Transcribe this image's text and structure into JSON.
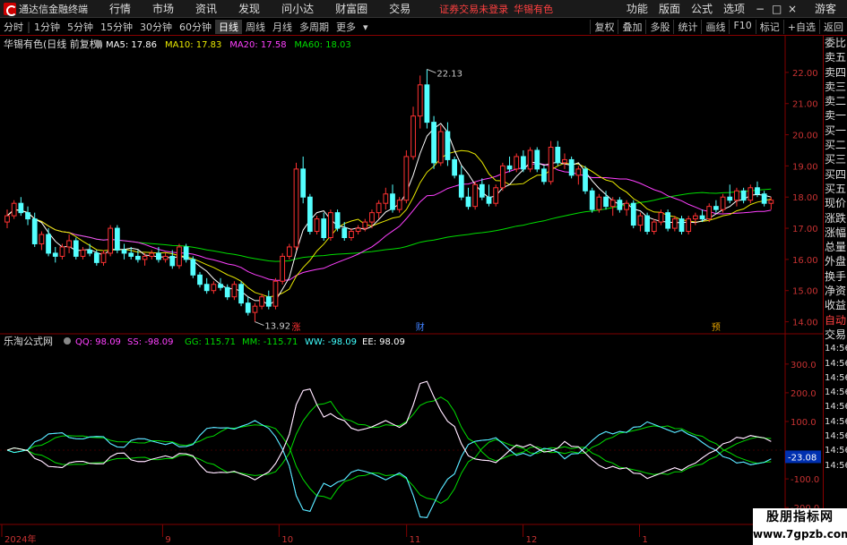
{
  "app": {
    "title": "通达信金融终端"
  },
  "menu": [
    "行情",
    "市场",
    "资讯",
    "发现",
    "问小达",
    "财富圈",
    "交易"
  ],
  "notice": {
    "text": "证券交易未登录",
    "symbol": "华锡有色"
  },
  "right_menu": [
    "功能",
    "版面",
    "公式",
    "选项"
  ],
  "guest": "游客",
  "window_buttons": {
    "min": "−",
    "max": "□",
    "close": "×"
  },
  "periods": [
    "分时",
    "1分钟",
    "5分钟",
    "15分钟",
    "30分钟",
    "60分钟",
    "日线",
    "周线",
    "月线",
    "多周期",
    "更多"
  ],
  "active_period": "日线",
  "toolbar_right": [
    "复权",
    "叠加",
    "多股",
    "统计",
    "画线",
    "F10",
    "标记",
    "+自选",
    "返回"
  ],
  "main_header": {
    "title": "华锡有色(日线 前复权)",
    "ma": [
      {
        "label": "MA5: 17.86",
        "color": "#ffffff"
      },
      {
        "label": "MA10: 17.83",
        "color": "#e8e800"
      },
      {
        "label": "MA20: 17.58",
        "color": "#ff40ff"
      },
      {
        "label": "MA60: 18.03",
        "color": "#00dd00"
      }
    ]
  },
  "price_axis": [
    "22.00",
    "21.00",
    "20.00",
    "19.00",
    "18.00",
    "17.00",
    "16.00",
    "15.00",
    "14.00"
  ],
  "price_markers": {
    "high": "22.13",
    "low": "13.92"
  },
  "event_markers": [
    "涨",
    "财",
    "预"
  ],
  "indicator_header": {
    "title": "乐淘公式网",
    "values": [
      {
        "label": "QQ: 98.09",
        "color": "#ff40ff"
      },
      {
        "label": "SS: -98.09",
        "color": "#ff40ff"
      },
      {
        "label": "GG: 115.71",
        "color": "#00dd00"
      },
      {
        "label": "MM: -115.71",
        "color": "#00dd00"
      },
      {
        "label": "WW: -98.09",
        "color": "#40ffff"
      },
      {
        "label": "EE: 98.09",
        "color": "#ffffff"
      }
    ]
  },
  "indicator_axis": [
    "300.0",
    "200.0",
    "100.0",
    "-100.0",
    "-200.0"
  ],
  "indicator_current": "-23.08",
  "date_axis": [
    "2024年",
    "9",
    "10",
    "11",
    "12",
    "1",
    "2"
  ],
  "right_panel": {
    "quote_labels": [
      "委比",
      "卖五",
      "卖四",
      "卖三",
      "卖二",
      "卖一",
      "买一",
      "买二",
      "买三",
      "买四",
      "买五",
      "现价",
      "涨跌",
      "涨幅",
      "总量",
      "外盘",
      "换手",
      "净资",
      "收益"
    ],
    "auto_label": "自动",
    "trade_label": "交易",
    "times": [
      "14:56",
      "14:56",
      "14:56",
      "14:56",
      "14:56",
      "14:56",
      "14:56",
      "14:56",
      "14:56"
    ]
  },
  "watermark": {
    "line1": "股朋指标网",
    "line2": "www.7gpzb.com"
  },
  "colors": {
    "up": "#ff3232",
    "down": "#54ffff",
    "grid": "#800000",
    "ma5": "#ffffff",
    "ma10": "#e8e800",
    "ma20": "#ff40ff",
    "ma60": "#00dd00"
  },
  "chart_data": {
    "type": "candlestick",
    "ylim": [
      13.7,
      22.6
    ],
    "indicator_ylim": [
      -240,
      340
    ],
    "candles": [
      [
        17.2,
        17.6,
        17.0,
        17.4
      ],
      [
        17.4,
        17.9,
        17.3,
        17.8
      ],
      [
        17.8,
        18.0,
        17.4,
        17.5
      ],
      [
        17.5,
        17.7,
        17.1,
        17.3
      ],
      [
        17.3,
        17.5,
        16.4,
        16.5
      ],
      [
        16.5,
        16.9,
        16.3,
        16.8
      ],
      [
        16.8,
        17.0,
        16.1,
        16.2
      ],
      [
        16.2,
        16.4,
        15.9,
        16.1
      ],
      [
        16.1,
        16.5,
        16.0,
        16.4
      ],
      [
        16.4,
        16.8,
        16.2,
        16.6
      ],
      [
        16.6,
        16.7,
        16.0,
        16.1
      ],
      [
        16.1,
        16.4,
        16.0,
        16.3
      ],
      [
        16.3,
        16.5,
        16.1,
        16.2
      ],
      [
        16.2,
        16.3,
        15.8,
        15.9
      ],
      [
        15.9,
        16.3,
        15.8,
        16.2
      ],
      [
        16.2,
        17.1,
        16.1,
        17.0
      ],
      [
        17.0,
        17.1,
        16.2,
        16.3
      ],
      [
        16.3,
        16.5,
        16.0,
        16.2
      ],
      [
        16.2,
        16.4,
        16.0,
        16.1
      ],
      [
        16.1,
        16.3,
        15.9,
        16.0
      ],
      [
        16.0,
        16.2,
        15.8,
        16.1
      ],
      [
        16.1,
        16.3,
        16.0,
        16.2
      ],
      [
        16.2,
        16.4,
        15.9,
        16.0
      ],
      [
        16.0,
        16.2,
        15.9,
        16.1
      ],
      [
        16.1,
        16.3,
        15.7,
        15.8
      ],
      [
        15.8,
        16.5,
        15.7,
        16.4
      ],
      [
        16.4,
        16.5,
        15.9,
        16.0
      ],
      [
        16.0,
        16.1,
        15.4,
        15.5
      ],
      [
        15.5,
        15.6,
        15.1,
        15.2
      ],
      [
        15.2,
        15.4,
        14.9,
        15.0
      ],
      [
        15.0,
        15.3,
        14.9,
        15.2
      ],
      [
        15.2,
        15.4,
        15.0,
        15.1
      ],
      [
        15.1,
        15.2,
        14.7,
        14.8
      ],
      [
        14.8,
        15.3,
        14.7,
        15.2
      ],
      [
        15.2,
        15.3,
        14.5,
        14.6
      ],
      [
        14.6,
        14.8,
        14.2,
        14.3
      ],
      [
        14.3,
        14.6,
        14.0,
        14.5
      ],
      [
        14.5,
        14.9,
        14.4,
        14.8
      ],
      [
        14.8,
        15.0,
        14.4,
        14.5
      ],
      [
        14.5,
        15.4,
        14.4,
        15.3
      ],
      [
        15.3,
        16.2,
        15.2,
        16.1
      ],
      [
        16.1,
        16.5,
        16.0,
        16.4
      ],
      [
        16.4,
        19.1,
        16.3,
        18.9
      ],
      [
        18.9,
        19.3,
        17.8,
        18.0
      ],
      [
        18.0,
        18.1,
        16.8,
        16.9
      ],
      [
        16.9,
        17.4,
        16.8,
        17.3
      ],
      [
        17.3,
        17.5,
        16.6,
        16.7
      ],
      [
        16.7,
        17.6,
        16.6,
        17.5
      ],
      [
        17.5,
        17.6,
        16.9,
        17.0
      ],
      [
        17.0,
        17.2,
        16.6,
        16.7
      ],
      [
        16.7,
        17.0,
        16.6,
        16.9
      ],
      [
        16.9,
        17.1,
        16.8,
        17.0
      ],
      [
        17.0,
        17.3,
        16.9,
        17.2
      ],
      [
        17.2,
        17.6,
        17.0,
        17.5
      ],
      [
        17.5,
        17.9,
        17.3,
        17.8
      ],
      [
        17.8,
        18.3,
        17.6,
        18.1
      ],
      [
        18.1,
        18.4,
        17.5,
        17.6
      ],
      [
        17.6,
        18.0,
        17.5,
        17.9
      ],
      [
        17.9,
        19.5,
        17.8,
        19.3
      ],
      [
        19.3,
        20.9,
        19.2,
        20.6
      ],
      [
        20.6,
        21.9,
        20.2,
        21.6
      ],
      [
        21.6,
        22.1,
        20.2,
        20.4
      ],
      [
        20.4,
        20.6,
        18.9,
        19.1
      ],
      [
        19.1,
        20.3,
        19.0,
        20.1
      ],
      [
        20.1,
        20.4,
        19.0,
        19.2
      ],
      [
        19.2,
        19.3,
        18.6,
        18.7
      ],
      [
        18.7,
        19.0,
        17.9,
        18.0
      ],
      [
        18.0,
        18.3,
        17.6,
        17.7
      ],
      [
        17.7,
        18.5,
        17.6,
        18.4
      ],
      [
        18.4,
        18.6,
        17.9,
        18.0
      ],
      [
        18.0,
        18.4,
        17.7,
        17.8
      ],
      [
        17.8,
        18.4,
        17.7,
        18.3
      ],
      [
        18.3,
        19.1,
        18.2,
        19.0
      ],
      [
        19.0,
        19.3,
        18.8,
        18.9
      ],
      [
        18.9,
        19.4,
        18.8,
        19.3
      ],
      [
        19.3,
        19.5,
        18.8,
        18.9
      ],
      [
        18.9,
        19.6,
        18.8,
        19.5
      ],
      [
        19.5,
        19.6,
        18.8,
        18.9
      ],
      [
        18.9,
        19.0,
        18.4,
        18.5
      ],
      [
        18.5,
        19.8,
        18.4,
        19.6
      ],
      [
        19.6,
        19.8,
        19.0,
        19.1
      ],
      [
        19.1,
        19.4,
        18.9,
        19.2
      ],
      [
        19.2,
        19.3,
        18.6,
        18.7
      ],
      [
        18.7,
        19.0,
        18.4,
        18.9
      ],
      [
        18.9,
        19.0,
        18.1,
        18.2
      ],
      [
        18.2,
        18.3,
        17.5,
        17.6
      ],
      [
        17.6,
        18.1,
        17.5,
        18.0
      ],
      [
        18.0,
        18.2,
        17.6,
        17.7
      ],
      [
        17.7,
        18.0,
        17.4,
        17.9
      ],
      [
        17.9,
        18.0,
        17.5,
        17.6
      ],
      [
        17.6,
        17.9,
        17.4,
        17.8
      ],
      [
        17.8,
        17.9,
        17.0,
        17.1
      ],
      [
        17.1,
        17.5,
        16.9,
        17.4
      ],
      [
        17.4,
        17.5,
        16.8,
        16.9
      ],
      [
        16.9,
        17.3,
        16.8,
        17.2
      ],
      [
        17.2,
        17.6,
        17.1,
        17.5
      ],
      [
        17.5,
        17.6,
        16.9,
        17.0
      ],
      [
        17.0,
        17.4,
        16.9,
        17.3
      ],
      [
        17.3,
        17.4,
        16.8,
        16.9
      ],
      [
        16.9,
        17.4,
        16.8,
        17.3
      ],
      [
        17.3,
        17.5,
        17.1,
        17.4
      ],
      [
        17.4,
        17.6,
        17.2,
        17.3
      ],
      [
        17.3,
        17.8,
        17.2,
        17.7
      ],
      [
        17.7,
        17.9,
        17.5,
        17.6
      ],
      [
        17.6,
        18.1,
        17.5,
        18.0
      ],
      [
        18.0,
        18.4,
        17.8,
        17.9
      ],
      [
        17.9,
        18.3,
        17.7,
        18.2
      ],
      [
        18.2,
        18.3,
        17.8,
        17.9
      ],
      [
        17.9,
        18.4,
        17.8,
        18.3
      ],
      [
        18.3,
        18.5,
        18.0,
        18.1
      ],
      [
        18.1,
        18.2,
        17.7,
        17.8
      ],
      [
        17.8,
        18.0,
        17.6,
        17.9
      ]
    ]
  }
}
